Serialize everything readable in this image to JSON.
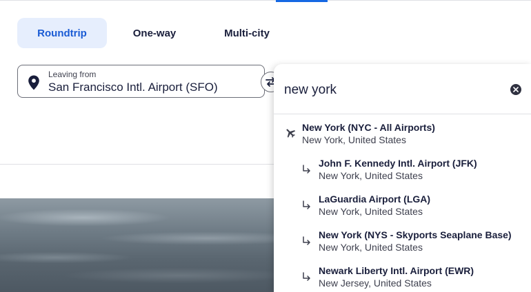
{
  "trip_types": [
    {
      "label": "Roundtrip",
      "active": true
    },
    {
      "label": "One-way",
      "active": false
    },
    {
      "label": "Multi-city",
      "active": false
    }
  ],
  "leaving_from": {
    "label": "Leaving from",
    "value": "San Francisco Intl. Airport (SFO)"
  },
  "search": {
    "value": "new york"
  },
  "results": [
    {
      "title": "New York (NYC - All Airports)",
      "subtitle": "New York, United States",
      "icon": "plane-icon",
      "nested": false
    },
    {
      "title": "John F. Kennedy Intl. Airport (JFK)",
      "subtitle": "New York, United States",
      "icon": "sub-location-arrow-icon",
      "nested": true
    },
    {
      "title": "LaGuardia Airport (LGA)",
      "subtitle": "New York, United States",
      "icon": "sub-location-arrow-icon",
      "nested": true
    },
    {
      "title": "New York (NYS - Skyports Seaplane Base)",
      "subtitle": "New York, United States",
      "icon": "sub-location-arrow-icon",
      "nested": true
    },
    {
      "title": "Newark Liberty Intl. Airport (EWR)",
      "subtitle": "New Jersey, United States",
      "icon": "sub-location-arrow-icon",
      "nested": true
    }
  ],
  "colors": {
    "accent": "#1668e3",
    "active_tab_bg": "#e6eefd",
    "text": "#191e3b"
  }
}
